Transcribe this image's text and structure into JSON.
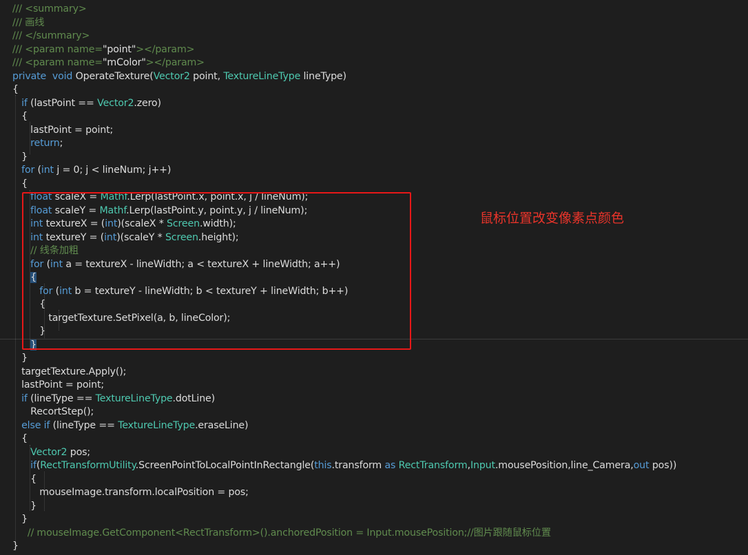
{
  "colors": {
    "background": "#1e1e1e",
    "default": "#dcdcdc",
    "keyword": "#569cd6",
    "type": "#4ec9b0",
    "comment": "#57a64a",
    "doc_tag": "#608b4e",
    "string": "#d69d85",
    "annotation": "#e8342a",
    "highlight_box": "#e81818"
  },
  "annotation": {
    "text": "鼠标位置改变像素点颜色"
  },
  "code_lines": [
    [
      [
        "c",
        "/// <summary>"
      ]
    ],
    [
      [
        "c",
        "/// 画线"
      ]
    ],
    [
      [
        "c",
        "/// </summary>"
      ]
    ],
    [
      [
        "c",
        "/// <param name="
      ],
      [
        "t",
        "\"point\""
      ],
      [
        "c",
        "></param>"
      ]
    ],
    [
      [
        "c",
        "/// <param name="
      ],
      [
        "t",
        "\"mColor\""
      ],
      [
        "c",
        "></param>"
      ]
    ],
    [
      [
        "k",
        "private"
      ],
      [
        "t",
        "  "
      ],
      [
        "k",
        "void"
      ],
      [
        "t",
        " OperateTexture("
      ],
      [
        "y",
        "Vector2"
      ],
      [
        "t",
        " point, "
      ],
      [
        "y",
        "TextureLineType"
      ],
      [
        "t",
        " lineType)"
      ]
    ],
    [
      [
        "t",
        "{"
      ]
    ],
    [
      [
        "t",
        "   "
      ],
      [
        "k",
        "if"
      ],
      [
        "t",
        " (lastPoint == "
      ],
      [
        "y",
        "Vector2"
      ],
      [
        "t",
        ".zero)"
      ]
    ],
    [
      [
        "t",
        "   {"
      ]
    ],
    [
      [
        "t",
        "      lastPoint = point;"
      ]
    ],
    [
      [
        "t",
        "      "
      ],
      [
        "k",
        "return"
      ],
      [
        "t",
        ";"
      ]
    ],
    [
      [
        "t",
        "   }"
      ]
    ],
    [
      [
        "t",
        "   "
      ],
      [
        "k",
        "for"
      ],
      [
        "t",
        " ("
      ],
      [
        "k",
        "int"
      ],
      [
        "t",
        " j = 0; j < lineNum; j++)"
      ]
    ],
    [
      [
        "t",
        "   {"
      ]
    ],
    [
      [
        "t",
        "      "
      ],
      [
        "k",
        "float"
      ],
      [
        "t",
        " scaleX = "
      ],
      [
        "y",
        "Mathf"
      ],
      [
        "t",
        ".Lerp(lastPoint.x, point.x, j / lineNum);"
      ]
    ],
    [
      [
        "t",
        "      "
      ],
      [
        "k",
        "float"
      ],
      [
        "t",
        " scaleY = "
      ],
      [
        "y",
        "Mathf"
      ],
      [
        "t",
        ".Lerp(lastPoint.y, point.y, j / lineNum);"
      ]
    ],
    [
      [
        "t",
        "      "
      ],
      [
        "k",
        "int"
      ],
      [
        "t",
        " textureX = ("
      ],
      [
        "k",
        "int"
      ],
      [
        "t",
        ")(scaleX * "
      ],
      [
        "y",
        "Screen"
      ],
      [
        "t",
        ".width);"
      ]
    ],
    [
      [
        "t",
        "      "
      ],
      [
        "k",
        "int"
      ],
      [
        "t",
        " textureY = ("
      ],
      [
        "k",
        "int"
      ],
      [
        "t",
        ")(scaleY * "
      ],
      [
        "y",
        "Screen"
      ],
      [
        "t",
        ".height);"
      ]
    ],
    [
      [
        "t",
        "      "
      ],
      [
        "c",
        "// 线条加粗"
      ]
    ],
    [
      [
        "t",
        "      "
      ],
      [
        "k",
        "for"
      ],
      [
        "t",
        " ("
      ],
      [
        "k",
        "int"
      ],
      [
        "t",
        " a = textureX - lineWidth; a < textureX + lineWidth; a++)"
      ]
    ],
    [
      [
        "t",
        "      "
      ],
      [
        "b",
        "{"
      ]
    ],
    [
      [
        "t",
        "         "
      ],
      [
        "k",
        "for"
      ],
      [
        "t",
        " ("
      ],
      [
        "k",
        "int"
      ],
      [
        "t",
        " b = textureY - lineWidth; b < textureY + lineWidth; b++)"
      ]
    ],
    [
      [
        "t",
        "         {"
      ]
    ],
    [
      [
        "t",
        "            targetTexture.SetPixel(a, b, lineColor);"
      ]
    ],
    [
      [
        "t",
        "         }"
      ]
    ],
    [
      [
        "t",
        "      "
      ],
      [
        "b",
        "}"
      ]
    ],
    [
      [
        "t",
        "   }"
      ]
    ],
    [
      [
        "t",
        "   targetTexture.Apply();"
      ]
    ],
    [
      [
        "t",
        "   lastPoint = point;"
      ]
    ],
    [
      [
        "t",
        "   "
      ],
      [
        "k",
        "if"
      ],
      [
        "t",
        " (lineType == "
      ],
      [
        "y",
        "TextureLineType"
      ],
      [
        "t",
        ".dotLine)"
      ]
    ],
    [
      [
        "t",
        "      RecortStep();"
      ]
    ],
    [
      [
        "t",
        "   "
      ],
      [
        "k",
        "else if"
      ],
      [
        "t",
        " (lineType == "
      ],
      [
        "y",
        "TextureLineType"
      ],
      [
        "t",
        ".eraseLine)"
      ]
    ],
    [
      [
        "t",
        "   {"
      ]
    ],
    [
      [
        "t",
        "      "
      ],
      [
        "y",
        "Vector2"
      ],
      [
        "t",
        " pos;"
      ]
    ],
    [
      [
        "t",
        "      "
      ],
      [
        "k",
        "if"
      ],
      [
        "t",
        "("
      ],
      [
        "y",
        "RectTransformUtility"
      ],
      [
        "t",
        ".ScreenPointToLocalPointInRectangle("
      ],
      [
        "k",
        "this"
      ],
      [
        "t",
        ".transform "
      ],
      [
        "k",
        "as"
      ],
      [
        "t",
        " "
      ],
      [
        "y",
        "RectTransform"
      ],
      [
        "t",
        ","
      ],
      [
        "y",
        "Input"
      ],
      [
        "t",
        ".mousePosition,line_Camera,"
      ],
      [
        "k",
        "out"
      ],
      [
        "t",
        " pos))"
      ]
    ],
    [
      [
        "t",
        "      {"
      ]
    ],
    [
      [
        "t",
        "         mouseImage.transform.localPosition = pos;"
      ]
    ],
    [
      [
        "t",
        "      }"
      ]
    ],
    [
      [
        "t",
        "   }"
      ]
    ],
    [
      [
        "t",
        "     "
      ],
      [
        "c",
        "// mouseImage.GetComponent<RectTransform>().anchoredPosition = Input.mousePosition;//图片跟随鼠标位置"
      ]
    ],
    [
      [
        "t",
        "}"
      ]
    ]
  ]
}
